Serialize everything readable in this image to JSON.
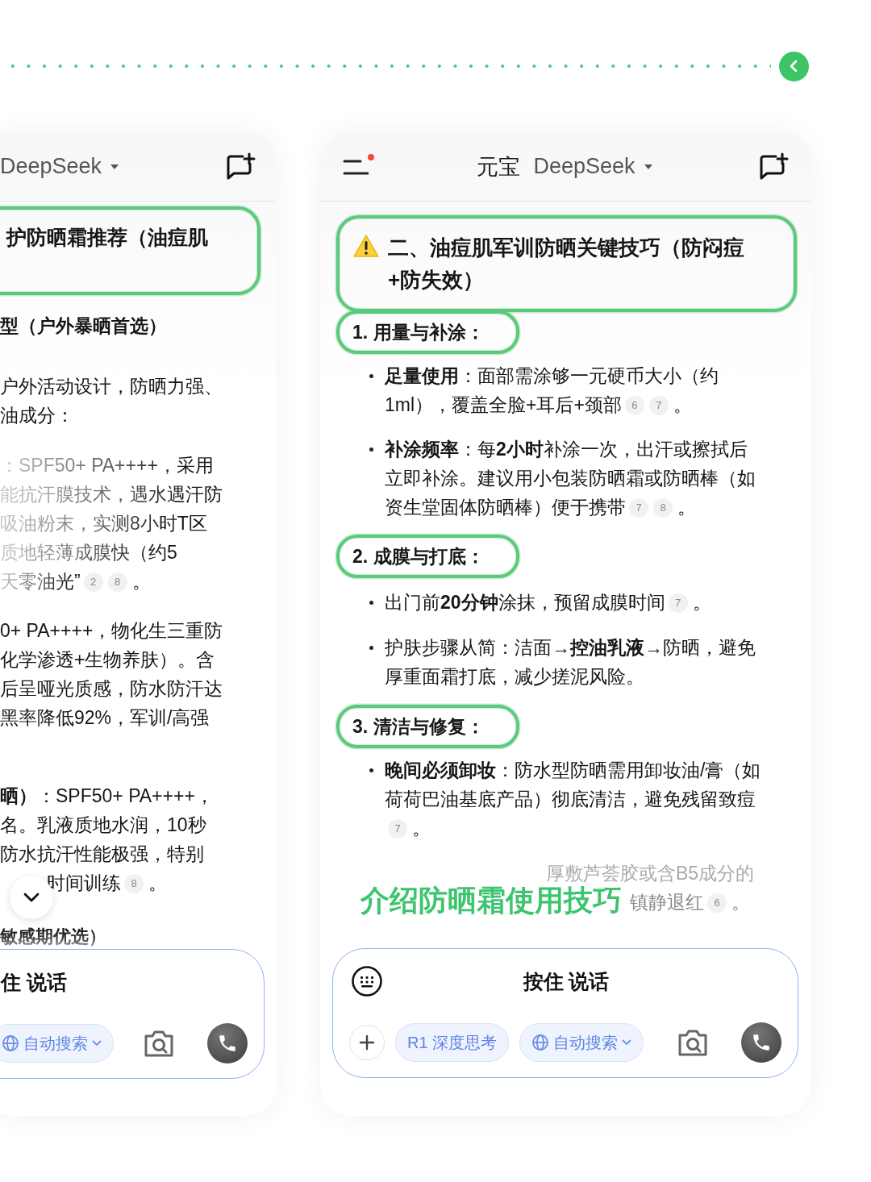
{
  "left_panel": {
    "header": {
      "title": "DeepSeek"
    },
    "heading": "护防晒霜推荐（油痘肌",
    "blocks": [
      {
        "kind": "subheading",
        "text": "型（户外暴晒首选）"
      },
      {
        "kind": "lines",
        "faded": false,
        "lines": [
          "户外活动设计，防晒力强、",
          "油成分："
        ]
      },
      {
        "kind": "lines",
        "faded": true,
        "lines": [
          "：SPF50+ PA++++，采用",
          "能抗汗膜技术，遇水遇汗防",
          "吸油粉末，实测8小时T区",
          "质地轻薄成膜快（约5",
          "天零油光”"
        ],
        "refs": [
          "2",
          "8"
        ],
        "end": "。"
      },
      {
        "kind": "lines",
        "faded": false,
        "lines": [
          "0+ PA++++，物化生三重防",
          "化学渗透+生物养肤）。含",
          "后呈哑光质感，防水防汗达",
          "黑率降低92%，军训/高强"
        ]
      },
      {
        "kind": "lines",
        "faded": false,
        "lines": [
          "**晒）**：SPF50+ PA++++，",
          "名。乳液质地水润，10秒",
          "防水抗汗性能极强，特别",
          "时间训练"
        ],
        "refs": [
          "8"
        ],
        "end": "。"
      },
      {
        "kind": "subheading",
        "text": "敏感期优选）"
      }
    ],
    "composer": {
      "prompt": "住 说话",
      "chips": [
        {
          "kind": "search",
          "label": "自动搜索"
        }
      ]
    }
  },
  "right_panel": {
    "header": {
      "brand": "元宝",
      "title": "DeepSeek",
      "notification": true
    },
    "heading": "二、油痘肌军训防晒关键技巧（防闷痘+防失效）",
    "sections": [
      {
        "title": "1. 用量与补涂：",
        "bullets": [
          {
            "text": "**足量使用**：面部需涂够一元硬币大小（约1ml），覆盖全脸+耳后+颈部",
            "refs": [
              "6",
              "7"
            ],
            "end": "。"
          },
          {
            "text": "**补涂频率**：每**2小时**补涂一次，出汗或擦拭后立即补涂。建议用小包装防晒霜或防晒棒（如资生堂固体防晒棒）便于携带",
            "refs": [
              "7",
              "8"
            ],
            "end": "。"
          }
        ]
      },
      {
        "title": "2. 成膜与打底：",
        "bullets": [
          {
            "text": "出门前**20分钟**涂抹，预留成膜时间",
            "refs": [
              "7"
            ],
            "end": "。"
          },
          {
            "text": "护肤步骤从简：洁面→**控油乳液**→防晒，避免厚重面霜打底，减少搓泥风险。"
          }
        ]
      },
      {
        "title": "3. 清洁与修复：",
        "bullets": [
          {
            "text": "**晚间必须卸妆**：防水型防晒需用卸妆油/膏（如荷荷巴油基底产品）彻底清洁，避免残留致痘",
            "refs": [
              "7"
            ],
            "end": "。"
          }
        ]
      }
    ],
    "trailing": {
      "lines": [
        "厚敷芦荟胶或含B5成分的",
        "镇静退红"
      ],
      "refs": [
        "6"
      ],
      "end": "。"
    },
    "overlay_title": "介绍防晒霜使用技巧",
    "composer": {
      "keyboard_button": true,
      "plus_button": true,
      "prompt": "按住 说话",
      "chips": [
        {
          "kind": "think",
          "label": "R1 深度思考"
        },
        {
          "kind": "search",
          "label": "自动搜索"
        }
      ]
    }
  }
}
